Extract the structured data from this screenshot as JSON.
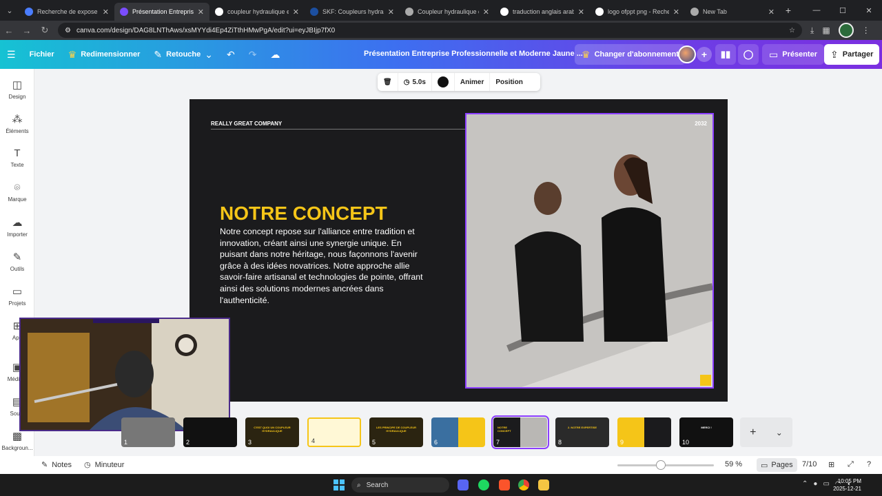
{
  "browser": {
    "tabs": [
      {
        "title": "Recherche de expose pr",
        "favicon_color": "#4a7dff"
      },
      {
        "title": "Présentation Entreprise",
        "favicon_color": "#7b4dff",
        "active": true
      },
      {
        "title": "coupleur hydraulique ex",
        "favicon_color": "#ffffff"
      },
      {
        "title": "SKF: Coupleurs hydrauli",
        "favicon_color": "#1c4fa0"
      },
      {
        "title": "Coupleur hydraulique d",
        "favicon_color": "#aaaaaa"
      },
      {
        "title": "traduction anglais arab",
        "favicon_color": "#ffffff"
      },
      {
        "title": "logo ofppt png - Reche",
        "favicon_color": "#ffffff"
      },
      {
        "title": "New Tab",
        "favicon_color": "#aaaaaa"
      }
    ],
    "url": "canva.com/design/DAG8LNThAws/xsMYYdi4Ep4ZiTthHMwPgA/edit?ui=eyJBIjp7fX0"
  },
  "canva_header": {
    "file_label": "Fichier",
    "resize_label": "Redimensionner",
    "retouch_label": "Retouche",
    "doc_title": "Présentation Entreprise Professionnelle et Moderne Jaune ...",
    "upgrade_label": "Changer d'abonnement",
    "present_label": "Présenter",
    "share_label": "Partager"
  },
  "sidebar": {
    "items": [
      {
        "label": "Design",
        "icon": "layout-icon"
      },
      {
        "label": "Éléments",
        "icon": "shapes-icon"
      },
      {
        "label": "Texte",
        "icon": "text-icon"
      },
      {
        "label": "Marque",
        "icon": "brand-icon"
      },
      {
        "label": "Importer",
        "icon": "upload-cloud-icon"
      },
      {
        "label": "Outils",
        "icon": "pen-tool-icon"
      },
      {
        "label": "Projets",
        "icon": "folder-icon"
      },
      {
        "label": "App",
        "icon": "apps-icon"
      },
      {
        "label": "Média n",
        "icon": "media-icon"
      },
      {
        "label": "Sous-",
        "icon": "subtitle-icon"
      },
      {
        "label": "Backgroun...",
        "icon": "background-icon"
      }
    ]
  },
  "element_toolbar": {
    "duration": "5.0s",
    "animate_label": "Animer",
    "position_label": "Position"
  },
  "slide": {
    "company": "REALLY GREAT COMPANY",
    "year": "2032",
    "title": "NOTRE CONCEPT",
    "body": "Notre concept repose sur l'alliance entre tradition et innovation, créant ainsi une synergie unique. En puisant dans notre héritage, nous façonnons l'avenir grâce à des idées novatrices. Notre approche allie savoir-faire artisanal et technologies de pointe, offrant ainsi des solutions modernes ancrées dans l'authenticité."
  },
  "thumbnails": [
    {
      "num": "1",
      "title": ""
    },
    {
      "num": "2",
      "title": ""
    },
    {
      "num": "3",
      "title": "C'EST QUOI UN COUPLEUR HYDRAULIQUE"
    },
    {
      "num": "4",
      "title": ""
    },
    {
      "num": "5",
      "title": "LES PRINCIPE DE COUPLEUR HYDRAULIQUE"
    },
    {
      "num": "6",
      "title": ""
    },
    {
      "num": "7",
      "title": "NOTRE CONCEPT"
    },
    {
      "num": "8",
      "title": "2. NOTRE EXPERTISE"
    },
    {
      "num": "9",
      "title": ""
    },
    {
      "num": "10",
      "title": "MERCI !"
    }
  ],
  "bottom_bar": {
    "notes_label": "Notes",
    "timer_label": "Minuteur",
    "zoom": "59 %",
    "pages_label": "Pages",
    "page_count": "7/10"
  },
  "taskbar": {
    "search_label": "Search",
    "time": "10:05 PM",
    "date": "2025-12-21"
  },
  "colors": {
    "accent": "#8b3dff",
    "slide_bg": "#1b1b1d",
    "title_yellow": "#f5c518"
  }
}
